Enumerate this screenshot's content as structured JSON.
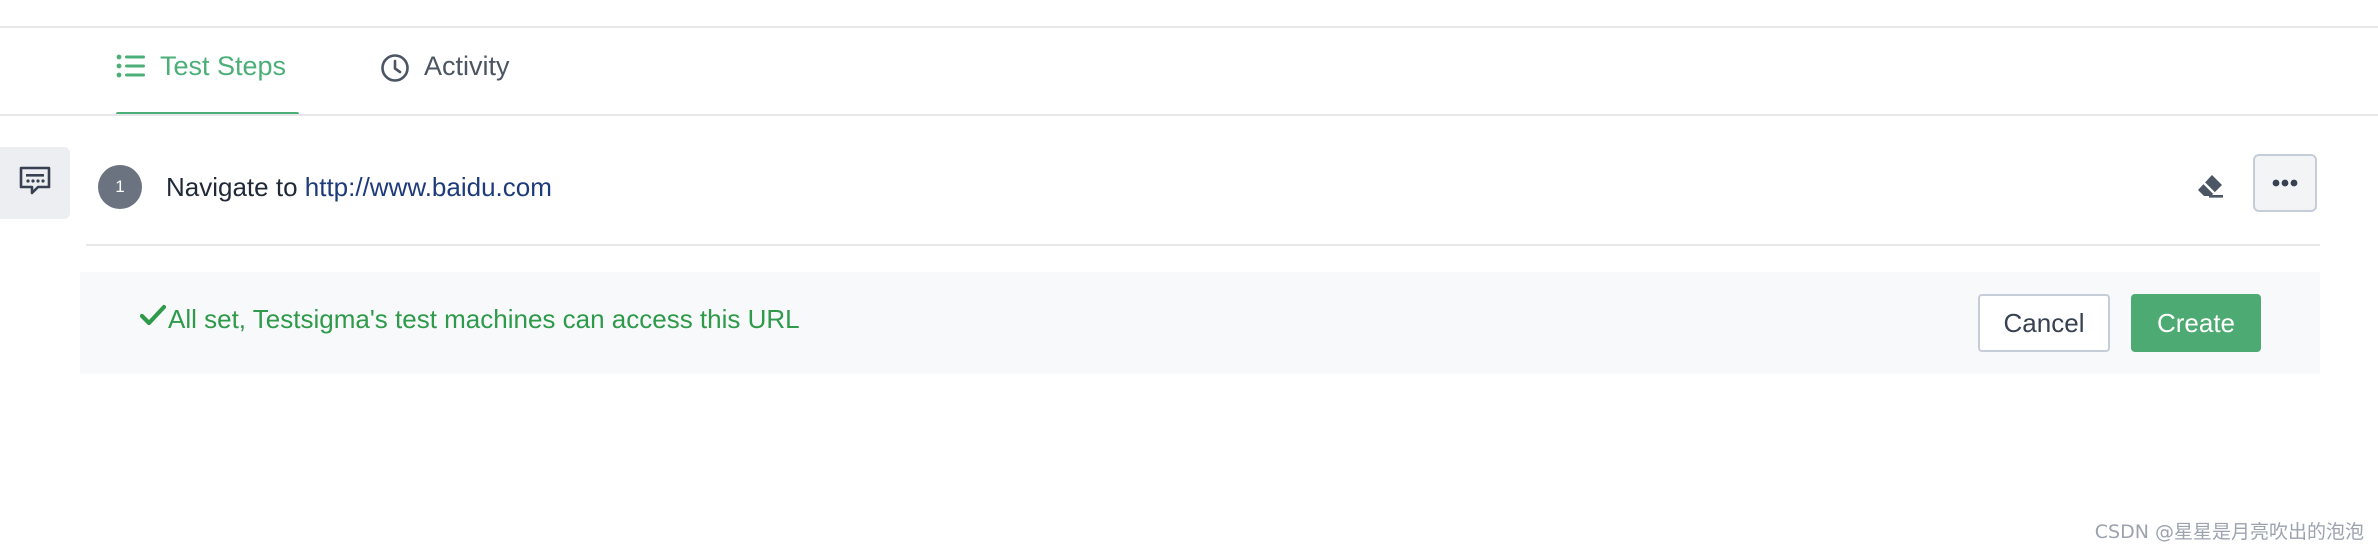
{
  "tabs": [
    {
      "label": "Test Steps",
      "icon": "list-icon",
      "active": true
    },
    {
      "label": "Activity",
      "icon": "clock-icon",
      "active": false
    }
  ],
  "sidebar": {
    "comment_icon": "comment-icon"
  },
  "step": {
    "number": "1",
    "action_text": "Navigate to",
    "url": "http://www.baidu.com",
    "eraser_icon": "eraser-icon",
    "more_icon": "more-horizontal-icon"
  },
  "validation": {
    "message": "All set, Testsigma's test machines can access this URL",
    "icon": "check-icon",
    "color": "#2e9a4a"
  },
  "buttons": {
    "cancel_label": "Cancel",
    "create_label": "Create"
  },
  "watermark": "CSDN @星星是月亮吹出的泡泡",
  "colors": {
    "accent": "#4caf78",
    "primary_button": "#4caa72"
  }
}
